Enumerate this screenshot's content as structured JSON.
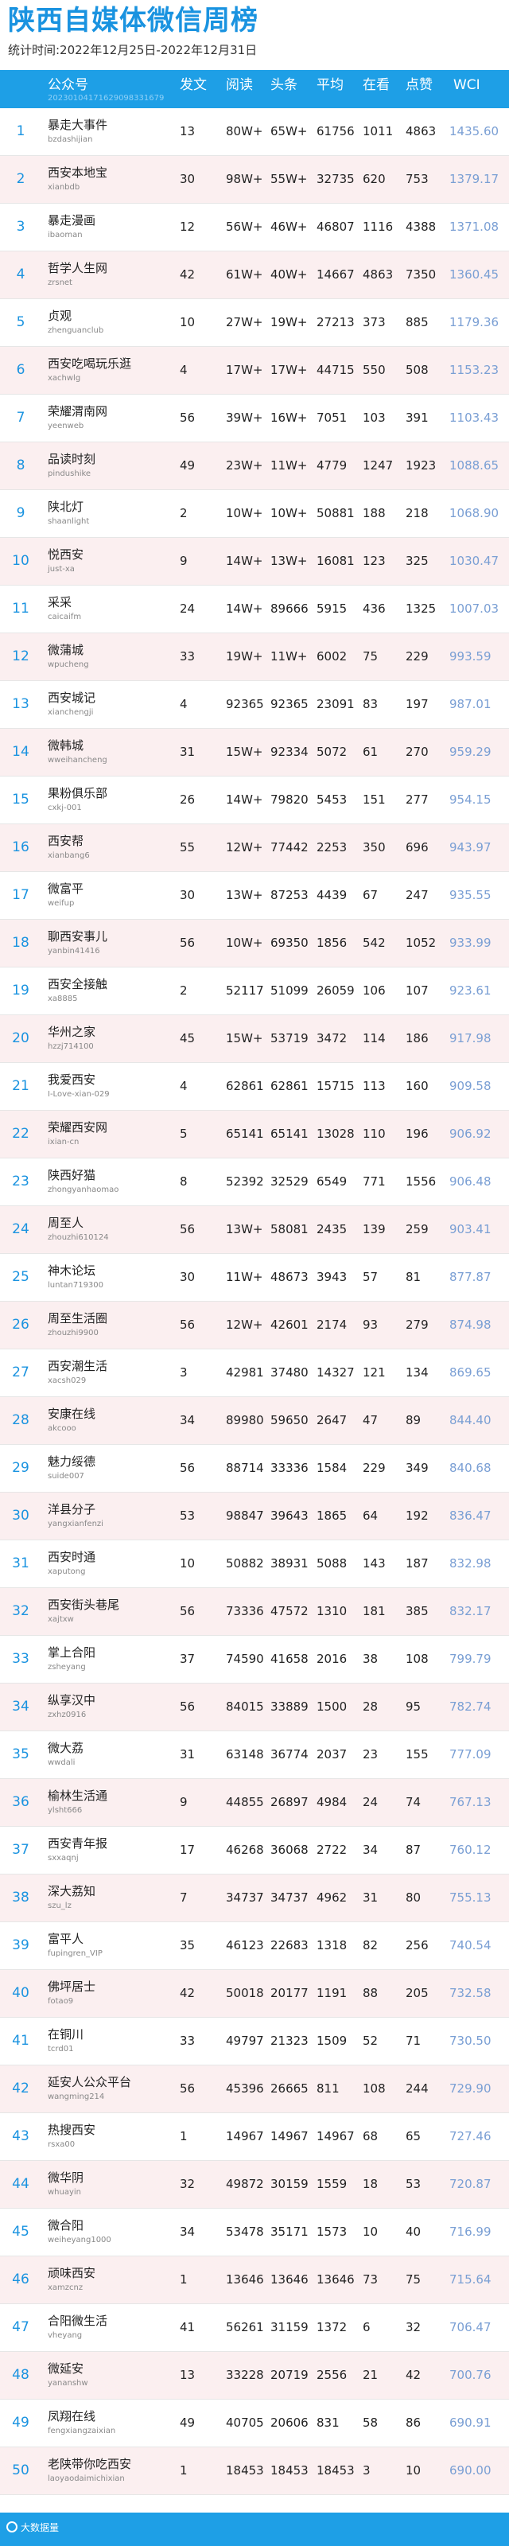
{
  "header": {
    "title": "陕西自媒体微信周榜",
    "subtitle": "统计时间:2022年12月25日-2022年12月31日"
  },
  "table": {
    "columns": {
      "account": "公众号",
      "account_sub": "20230104171629098331679",
      "posts": "发文",
      "reads": "阅读",
      "headline": "头条",
      "average": "平均",
      "looks": "在看",
      "likes": "点赞",
      "wci": "WCI"
    },
    "rows": [
      {
        "rank": "1",
        "name": "暴走大事件",
        "account": "bzdashijian",
        "posts": "13",
        "reads": "80W+",
        "headline": "65W+",
        "average": "61756",
        "looks": "1011",
        "likes": "4863",
        "wci": "1435.60"
      },
      {
        "rank": "2",
        "name": "西安本地宝",
        "account": "xianbdb",
        "posts": "30",
        "reads": "98W+",
        "headline": "55W+",
        "average": "32735",
        "looks": "620",
        "likes": "753",
        "wci": "1379.17"
      },
      {
        "rank": "3",
        "name": "暴走漫画",
        "account": "ibaoman",
        "posts": "12",
        "reads": "56W+",
        "headline": "46W+",
        "average": "46807",
        "looks": "1116",
        "likes": "4388",
        "wci": "1371.08"
      },
      {
        "rank": "4",
        "name": "哲学人生网",
        "account": "zrsnet",
        "posts": "42",
        "reads": "61W+",
        "headline": "40W+",
        "average": "14667",
        "looks": "4863",
        "likes": "7350",
        "wci": "1360.45"
      },
      {
        "rank": "5",
        "name": "贞观",
        "account": "zhenguanclub",
        "posts": "10",
        "reads": "27W+",
        "headline": "19W+",
        "average": "27213",
        "looks": "373",
        "likes": "885",
        "wci": "1179.36"
      },
      {
        "rank": "6",
        "name": "西安吃喝玩乐逛",
        "account": "xachwlg",
        "posts": "4",
        "reads": "17W+",
        "headline": "17W+",
        "average": "44715",
        "looks": "550",
        "likes": "508",
        "wci": "1153.23"
      },
      {
        "rank": "7",
        "name": "荣耀渭南网",
        "account": "yeenweb",
        "posts": "56",
        "reads": "39W+",
        "headline": "16W+",
        "average": "7051",
        "looks": "103",
        "likes": "391",
        "wci": "1103.43"
      },
      {
        "rank": "8",
        "name": "品读时刻",
        "account": "pindushike",
        "posts": "49",
        "reads": "23W+",
        "headline": "11W+",
        "average": "4779",
        "looks": "1247",
        "likes": "1923",
        "wci": "1088.65"
      },
      {
        "rank": "9",
        "name": "陕北灯",
        "account": "shaanlight",
        "posts": "2",
        "reads": "10W+",
        "headline": "10W+",
        "average": "50881",
        "looks": "188",
        "likes": "218",
        "wci": "1068.90"
      },
      {
        "rank": "10",
        "name": "悦西安",
        "account": "just-xa",
        "posts": "9",
        "reads": "14W+",
        "headline": "13W+",
        "average": "16081",
        "looks": "123",
        "likes": "325",
        "wci": "1030.47"
      },
      {
        "rank": "11",
        "name": "采采",
        "account": "caicaifm",
        "posts": "24",
        "reads": "14W+",
        "headline": "89666",
        "average": "5915",
        "looks": "436",
        "likes": "1325",
        "wci": "1007.03"
      },
      {
        "rank": "12",
        "name": "微蒲城",
        "account": "wpucheng",
        "posts": "33",
        "reads": "19W+",
        "headline": "11W+",
        "average": "6002",
        "looks": "75",
        "likes": "229",
        "wci": "993.59"
      },
      {
        "rank": "13",
        "name": "西安城记",
        "account": "xianchengji",
        "posts": "4",
        "reads": "92365",
        "headline": "92365",
        "average": "23091",
        "looks": "83",
        "likes": "197",
        "wci": "987.01"
      },
      {
        "rank": "14",
        "name": "微韩城",
        "account": "wweihancheng",
        "posts": "31",
        "reads": "15W+",
        "headline": "92334",
        "average": "5072",
        "looks": "61",
        "likes": "270",
        "wci": "959.29"
      },
      {
        "rank": "15",
        "name": "果粉俱乐部",
        "account": "cxkj-001",
        "posts": "26",
        "reads": "14W+",
        "headline": "79820",
        "average": "5453",
        "looks": "151",
        "likes": "277",
        "wci": "954.15"
      },
      {
        "rank": "16",
        "name": "西安帮",
        "account": "xianbang6",
        "posts": "55",
        "reads": "12W+",
        "headline": "77442",
        "average": "2253",
        "looks": "350",
        "likes": "696",
        "wci": "943.97"
      },
      {
        "rank": "17",
        "name": "微富平",
        "account": "weifup",
        "posts": "30",
        "reads": "13W+",
        "headline": "87253",
        "average": "4439",
        "looks": "67",
        "likes": "247",
        "wci": "935.55"
      },
      {
        "rank": "18",
        "name": "聊西安事儿",
        "account": "yanbin41416",
        "posts": "56",
        "reads": "10W+",
        "headline": "69350",
        "average": "1856",
        "looks": "542",
        "likes": "1052",
        "wci": "933.99"
      },
      {
        "rank": "19",
        "name": "西安全接触",
        "account": "xa8885",
        "posts": "2",
        "reads": "52117",
        "headline": "51099",
        "average": "26059",
        "looks": "106",
        "likes": "107",
        "wci": "923.61"
      },
      {
        "rank": "20",
        "name": "华州之家",
        "account": "hzzj714100",
        "posts": "45",
        "reads": "15W+",
        "headline": "53719",
        "average": "3472",
        "looks": "114",
        "likes": "186",
        "wci": "917.98"
      },
      {
        "rank": "21",
        "name": "我爱西安",
        "account": "I-Love-xian-029",
        "posts": "4",
        "reads": "62861",
        "headline": "62861",
        "average": "15715",
        "looks": "113",
        "likes": "160",
        "wci": "909.58"
      },
      {
        "rank": "22",
        "name": "荣耀西安网",
        "account": "ixian-cn",
        "posts": "5",
        "reads": "65141",
        "headline": "65141",
        "average": "13028",
        "looks": "110",
        "likes": "196",
        "wci": "906.92"
      },
      {
        "rank": "23",
        "name": "陕西好猫",
        "account": "zhongyanhaomao",
        "posts": "8",
        "reads": "52392",
        "headline": "32529",
        "average": "6549",
        "looks": "771",
        "likes": "1556",
        "wci": "906.48"
      },
      {
        "rank": "24",
        "name": "周至人",
        "account": "zhouzhi610124",
        "posts": "56",
        "reads": "13W+",
        "headline": "58081",
        "average": "2435",
        "looks": "139",
        "likes": "259",
        "wci": "903.41"
      },
      {
        "rank": "25",
        "name": "神木论坛",
        "account": "luntan719300",
        "posts": "30",
        "reads": "11W+",
        "headline": "48673",
        "average": "3943",
        "looks": "57",
        "likes": "81",
        "wci": "877.87"
      },
      {
        "rank": "26",
        "name": "周至生活圈",
        "account": "zhouzhi9900",
        "posts": "56",
        "reads": "12W+",
        "headline": "42601",
        "average": "2174",
        "looks": "93",
        "likes": "279",
        "wci": "874.98"
      },
      {
        "rank": "27",
        "name": "西安潮生活",
        "account": "xacsh029",
        "posts": "3",
        "reads": "42981",
        "headline": "37480",
        "average": "14327",
        "looks": "121",
        "likes": "134",
        "wci": "869.65"
      },
      {
        "rank": "28",
        "name": "安康在线",
        "account": "akcooo",
        "posts": "34",
        "reads": "89980",
        "headline": "59650",
        "average": "2647",
        "looks": "47",
        "likes": "89",
        "wci": "844.40"
      },
      {
        "rank": "29",
        "name": "魅力绥德",
        "account": "suide007",
        "posts": "56",
        "reads": "88714",
        "headline": "33336",
        "average": "1584",
        "looks": "229",
        "likes": "349",
        "wci": "840.68"
      },
      {
        "rank": "30",
        "name": "洋县分子",
        "account": "yangxianfenzi",
        "posts": "53",
        "reads": "98847",
        "headline": "39643",
        "average": "1865",
        "looks": "64",
        "likes": "192",
        "wci": "836.47"
      },
      {
        "rank": "31",
        "name": "西安时通",
        "account": "xaputong",
        "posts": "10",
        "reads": "50882",
        "headline": "38931",
        "average": "5088",
        "looks": "143",
        "likes": "187",
        "wci": "832.98"
      },
      {
        "rank": "32",
        "name": "西安街头巷尾",
        "account": "xajtxw",
        "posts": "56",
        "reads": "73336",
        "headline": "47572",
        "average": "1310",
        "looks": "181",
        "likes": "385",
        "wci": "832.17"
      },
      {
        "rank": "33",
        "name": "掌上合阳",
        "account": "zsheyang",
        "posts": "37",
        "reads": "74590",
        "headline": "41658",
        "average": "2016",
        "looks": "38",
        "likes": "108",
        "wci": "799.79"
      },
      {
        "rank": "34",
        "name": "纵享汉中",
        "account": "zxhz0916",
        "posts": "56",
        "reads": "84015",
        "headline": "33889",
        "average": "1500",
        "looks": "28",
        "likes": "95",
        "wci": "782.74"
      },
      {
        "rank": "35",
        "name": "微大荔",
        "account": "wwdali",
        "posts": "31",
        "reads": "63148",
        "headline": "36774",
        "average": "2037",
        "looks": "23",
        "likes": "155",
        "wci": "777.09"
      },
      {
        "rank": "36",
        "name": "榆林生活通",
        "account": "ylsht666",
        "posts": "9",
        "reads": "44855",
        "headline": "26897",
        "average": "4984",
        "looks": "24",
        "likes": "74",
        "wci": "767.13"
      },
      {
        "rank": "37",
        "name": "西安青年报",
        "account": "sxxaqnj",
        "posts": "17",
        "reads": "46268",
        "headline": "36068",
        "average": "2722",
        "looks": "34",
        "likes": "87",
        "wci": "760.12"
      },
      {
        "rank": "38",
        "name": "深大荔知",
        "account": "szu_lz",
        "posts": "7",
        "reads": "34737",
        "headline": "34737",
        "average": "4962",
        "looks": "31",
        "likes": "80",
        "wci": "755.13"
      },
      {
        "rank": "39",
        "name": "富平人",
        "account": "fupingren_VIP",
        "posts": "35",
        "reads": "46123",
        "headline": "22683",
        "average": "1318",
        "looks": "82",
        "likes": "256",
        "wci": "740.54"
      },
      {
        "rank": "40",
        "name": "佛坪居士",
        "account": "fotao9",
        "posts": "42",
        "reads": "50018",
        "headline": "20177",
        "average": "1191",
        "looks": "88",
        "likes": "205",
        "wci": "732.58"
      },
      {
        "rank": "41",
        "name": "在铜川",
        "account": "tcrd01",
        "posts": "33",
        "reads": "49797",
        "headline": "21323",
        "average": "1509",
        "looks": "52",
        "likes": "71",
        "wci": "730.50"
      },
      {
        "rank": "42",
        "name": "延安人公众平台",
        "account": "wangming214",
        "posts": "56",
        "reads": "45396",
        "headline": "26665",
        "average": "811",
        "looks": "108",
        "likes": "244",
        "wci": "729.90"
      },
      {
        "rank": "43",
        "name": "热搜西安",
        "account": "rsxa00",
        "posts": "1",
        "reads": "14967",
        "headline": "14967",
        "average": "14967",
        "looks": "68",
        "likes": "65",
        "wci": "727.46"
      },
      {
        "rank": "44",
        "name": "微华阴",
        "account": "whuayin",
        "posts": "32",
        "reads": "49872",
        "headline": "30159",
        "average": "1559",
        "looks": "18",
        "likes": "53",
        "wci": "720.87"
      },
      {
        "rank": "45",
        "name": "微合阳",
        "account": "weiheyang1000",
        "posts": "34",
        "reads": "53478",
        "headline": "35171",
        "average": "1573",
        "looks": "10",
        "likes": "40",
        "wci": "716.99"
      },
      {
        "rank": "46",
        "name": "顽味西安",
        "account": "xamzcnz",
        "posts": "1",
        "reads": "13646",
        "headline": "13646",
        "average": "13646",
        "looks": "73",
        "likes": "75",
        "wci": "715.64"
      },
      {
        "rank": "47",
        "name": "合阳微生活",
        "account": "vheyang",
        "posts": "41",
        "reads": "56261",
        "headline": "31159",
        "average": "1372",
        "looks": "6",
        "likes": "32",
        "wci": "706.47"
      },
      {
        "rank": "48",
        "name": "微延安",
        "account": "yananshw",
        "posts": "13",
        "reads": "33228",
        "headline": "20719",
        "average": "2556",
        "looks": "21",
        "likes": "42",
        "wci": "700.76"
      },
      {
        "rank": "49",
        "name": "凤翔在线",
        "account": "fengxiangzaixian",
        "posts": "49",
        "reads": "40705",
        "headline": "20606",
        "average": "831",
        "looks": "58",
        "likes": "86",
        "wci": "690.91"
      },
      {
        "rank": "50",
        "name": "老陕带你吃西安",
        "account": "laoyaodaimichixian",
        "posts": "1",
        "reads": "18453",
        "headline": "18453",
        "average": "18453",
        "looks": "3",
        "likes": "10",
        "wci": "690.00"
      }
    ]
  },
  "footer": {
    "logo_text": "大数据量"
  }
}
